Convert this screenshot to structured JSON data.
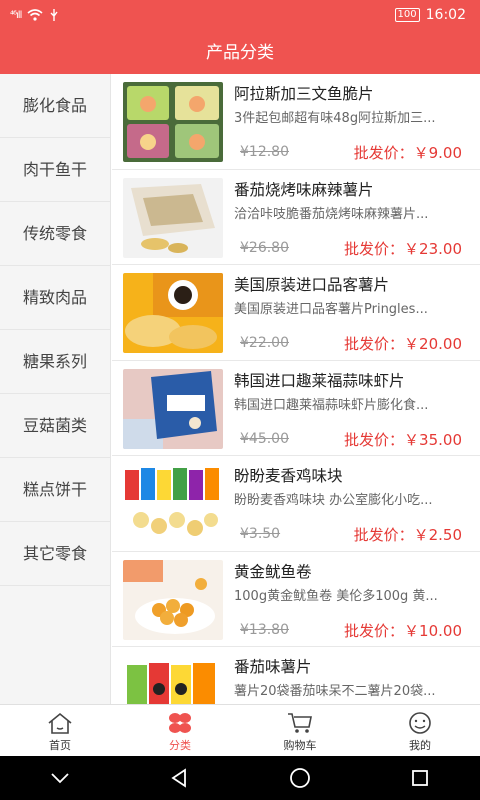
{
  "status": {
    "signal": "⁴⁶ıll",
    "battery": "100",
    "time": "16:02"
  },
  "header": {
    "title": "产品分类"
  },
  "sidebar": {
    "items": [
      {
        "label": "膨化食品"
      },
      {
        "label": "肉干鱼干"
      },
      {
        "label": "传统零食"
      },
      {
        "label": "精致肉品"
      },
      {
        "label": "糖果系列"
      },
      {
        "label": "豆菇菌类"
      },
      {
        "label": "糕点饼干"
      },
      {
        "label": "其它零食"
      }
    ]
  },
  "products": [
    {
      "title": "阿拉斯加三文鱼脆片",
      "desc": "3件起包邮超有味48g阿拉斯加三...",
      "orig": "¥12.80",
      "price": "批发价：￥9.00"
    },
    {
      "title": "番茄烧烤味麻辣薯片",
      "desc": "洽洽咔吱脆番茄烧烤味麻辣薯片...",
      "orig": "¥26.80",
      "price": "批发价：￥23.00"
    },
    {
      "title": "美国原装进口品客薯片",
      "desc": "美国原装进口品客薯片Pringles...",
      "orig": "¥22.00",
      "price": "批发价：￥20.00"
    },
    {
      "title": "韩国进口趣莱福蒜味虾片",
      "desc": "韩国进口趣莱福蒜味虾片膨化食...",
      "orig": "¥45.00",
      "price": "批发价：￥35.00"
    },
    {
      "title": "盼盼麦香鸡味块",
      "desc": "盼盼麦香鸡味块 办公室膨化小吃...",
      "orig": "¥3.50",
      "price": "批发价：￥2.50"
    },
    {
      "title": "黄金鱿鱼卷",
      "desc": "100g黄金鱿鱼卷 美伦多100g 黄...",
      "orig": "¥13.80",
      "price": "批发价：￥10.00"
    },
    {
      "title": "番茄味薯片",
      "desc": "薯片20袋番茄味呆不二薯片20袋...",
      "orig": "",
      "price": ""
    }
  ],
  "tabs": [
    {
      "label": "首页",
      "icon": "home-icon"
    },
    {
      "label": "分类",
      "icon": "category-icon"
    },
    {
      "label": "购物车",
      "icon": "cart-icon"
    },
    {
      "label": "我的",
      "icon": "smile-icon"
    }
  ],
  "colors": {
    "accent": "#ef5350",
    "price": "#e53935"
  }
}
